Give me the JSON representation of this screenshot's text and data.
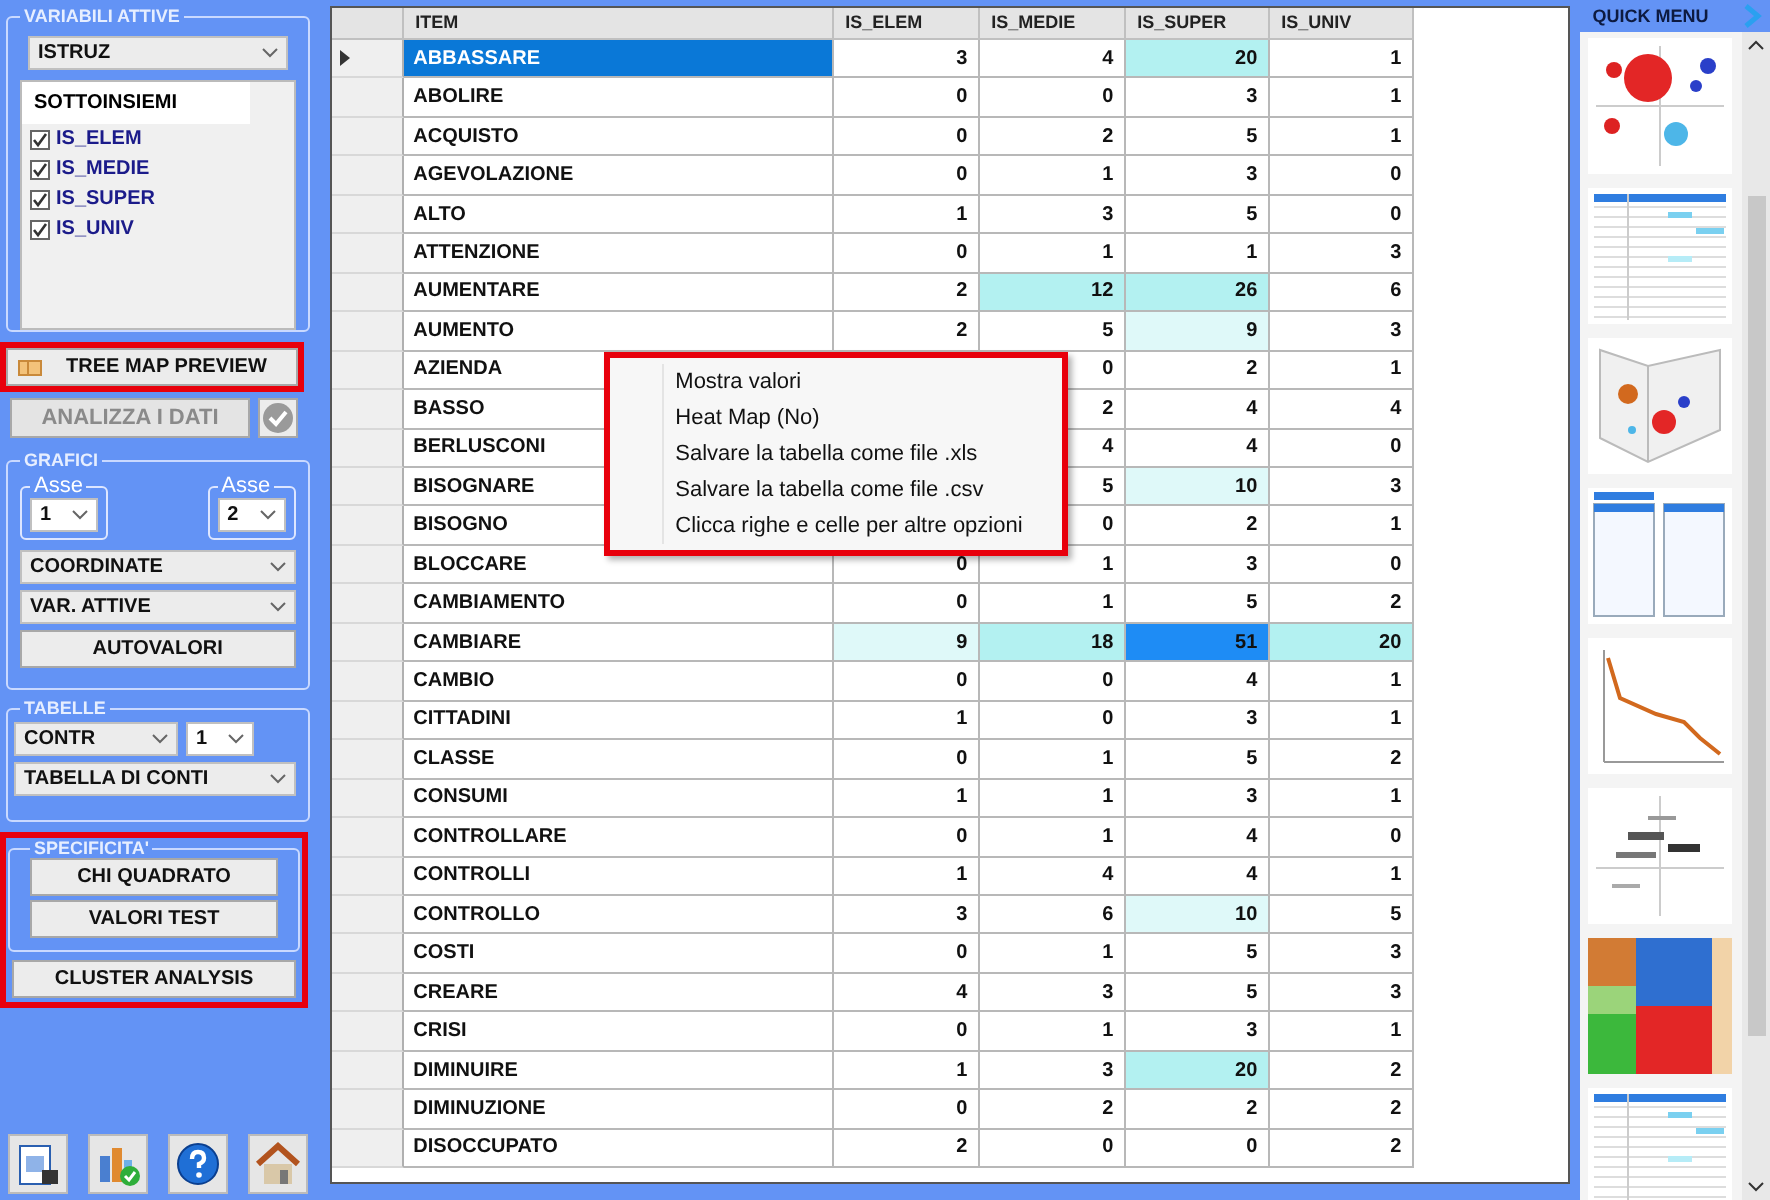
{
  "sidebar": {
    "active_variables": {
      "title": "VARIABILI ATTIVE",
      "dropdown": "ISTRUZ",
      "list_header": "SOTTOINSIEMI",
      "subsets": [
        {
          "label": "IS_ELEM",
          "checked": true
        },
        {
          "label": "IS_MEDIE",
          "checked": true
        },
        {
          "label": "IS_SUPER",
          "checked": true
        },
        {
          "label": "IS_UNIV",
          "checked": true
        }
      ]
    },
    "tree_map_button": {
      "label": "TREE MAP PREVIEW",
      "highlighted": true
    },
    "analyze_button": {
      "label": "ANALIZZA I DATI",
      "disabled": true
    },
    "charts": {
      "title": "GRAFICI",
      "axes": [
        {
          "label": "Asse",
          "value": "1"
        },
        {
          "label": "Asse",
          "value": "2"
        }
      ],
      "dropdowns": [
        "COORDINATE",
        "VAR. ATTIVE"
      ],
      "button": "AUTOVALORI"
    },
    "tables": {
      "title": "TABELLE",
      "dropdowns": [
        "CONTR",
        "1",
        "TABELLA DI CONTI"
      ]
    },
    "specificity": {
      "title": "SPECIFICITA'",
      "buttons": [
        "CHI QUADRATO",
        "VALORI TEST"
      ],
      "highlighted": true
    },
    "cluster_button": {
      "label": "CLUSTER ANALYSIS"
    }
  },
  "table": {
    "columns": [
      "ITEM",
      "IS_ELEM",
      "IS_MEDIE",
      "IS_SUPER",
      "IS_UNIV"
    ],
    "rows": [
      {
        "item": "ABBASSARE",
        "selected": true,
        "is_elem": {
          "value": "3"
        },
        "is_medie": {
          "value": "4"
        },
        "is_super": {
          "value": "20",
          "color": "#b3f1f1"
        },
        "is_univ": {
          "value": "1"
        }
      },
      {
        "item": "ABOLIRE",
        "selected": false,
        "is_elem": {
          "value": "0"
        },
        "is_medie": {
          "value": "0"
        },
        "is_super": {
          "value": "3"
        },
        "is_univ": {
          "value": "1"
        }
      },
      {
        "item": "ACQUISTO",
        "selected": false,
        "is_elem": {
          "value": "0"
        },
        "is_medie": {
          "value": "2"
        },
        "is_super": {
          "value": "5"
        },
        "is_univ": {
          "value": "1"
        }
      },
      {
        "item": "AGEVOLAZIONE",
        "selected": false,
        "is_elem": {
          "value": "0"
        },
        "is_medie": {
          "value": "1"
        },
        "is_super": {
          "value": "3"
        },
        "is_univ": {
          "value": "0"
        }
      },
      {
        "item": "ALTO",
        "selected": false,
        "is_elem": {
          "value": "1"
        },
        "is_medie": {
          "value": "3"
        },
        "is_super": {
          "value": "5"
        },
        "is_univ": {
          "value": "0"
        }
      },
      {
        "item": "ATTENZIONE",
        "selected": false,
        "is_elem": {
          "value": "0"
        },
        "is_medie": {
          "value": "1"
        },
        "is_super": {
          "value": "1"
        },
        "is_univ": {
          "value": "3"
        }
      },
      {
        "item": "AUMENTARE",
        "selected": false,
        "is_elem": {
          "value": "2"
        },
        "is_medie": {
          "value": "12",
          "color": "#b3f1f1"
        },
        "is_super": {
          "value": "26",
          "color": "#b3f1f1"
        },
        "is_univ": {
          "value": "6"
        }
      },
      {
        "item": "AUMENTO",
        "selected": false,
        "is_elem": {
          "value": "2"
        },
        "is_medie": {
          "value": "5"
        },
        "is_super": {
          "value": "9",
          "color": "#dff9f9"
        },
        "is_univ": {
          "value": "3"
        }
      },
      {
        "item": "AZIENDA",
        "selected": false,
        "is_medie": {
          "value": "0"
        },
        "is_super": {
          "value": "2"
        },
        "is_univ": {
          "value": "1"
        }
      },
      {
        "item": "BASSO",
        "selected": false,
        "is_medie": {
          "value": "2"
        },
        "is_super": {
          "value": "4"
        },
        "is_univ": {
          "value": "4"
        }
      },
      {
        "item": "BERLUSCONI",
        "selected": false,
        "is_medie": {
          "value": "4"
        },
        "is_super": {
          "value": "4"
        },
        "is_univ": {
          "value": "0"
        }
      },
      {
        "item": "BISOGNARE",
        "selected": false,
        "is_medie": {
          "value": "5"
        },
        "is_super": {
          "value": "10",
          "color": "#dff9f9"
        },
        "is_univ": {
          "value": "3"
        }
      },
      {
        "item": "BISOGNO",
        "selected": false,
        "is_medie": {
          "value": "0"
        },
        "is_super": {
          "value": "2"
        },
        "is_univ": {
          "value": "1"
        }
      },
      {
        "item": "BLOCCARE",
        "selected": false,
        "is_elem": {
          "value": "0"
        },
        "is_medie": {
          "value": "1"
        },
        "is_super": {
          "value": "3"
        },
        "is_univ": {
          "value": "0"
        }
      },
      {
        "item": "CAMBIAMENTO",
        "selected": false,
        "is_elem": {
          "value": "0"
        },
        "is_medie": {
          "value": "1"
        },
        "is_super": {
          "value": "5"
        },
        "is_univ": {
          "value": "2"
        }
      },
      {
        "item": "CAMBIARE",
        "selected": false,
        "is_elem": {
          "value": "9",
          "color": "#dff9f9"
        },
        "is_medie": {
          "value": "18",
          "color": "#b3f1f1"
        },
        "is_super": {
          "value": "51",
          "color": "#1e8cf5"
        },
        "is_univ": {
          "value": "20",
          "color": "#b3f1f1"
        }
      },
      {
        "item": "CAMBIO",
        "selected": false,
        "is_elem": {
          "value": "0"
        },
        "is_medie": {
          "value": "0"
        },
        "is_super": {
          "value": "4"
        },
        "is_univ": {
          "value": "1"
        }
      },
      {
        "item": "CITTADINI",
        "selected": false,
        "is_elem": {
          "value": "1"
        },
        "is_medie": {
          "value": "0"
        },
        "is_super": {
          "value": "3"
        },
        "is_univ": {
          "value": "1"
        }
      },
      {
        "item": "CLASSE",
        "selected": false,
        "is_elem": {
          "value": "0"
        },
        "is_medie": {
          "value": "1"
        },
        "is_super": {
          "value": "5"
        },
        "is_univ": {
          "value": "2"
        }
      },
      {
        "item": "CONSUMI",
        "selected": false,
        "is_elem": {
          "value": "1"
        },
        "is_medie": {
          "value": "1"
        },
        "is_super": {
          "value": "3"
        },
        "is_univ": {
          "value": "1"
        }
      },
      {
        "item": "CONTROLLARE",
        "selected": false,
        "is_elem": {
          "value": "0"
        },
        "is_medie": {
          "value": "1"
        },
        "is_super": {
          "value": "4"
        },
        "is_univ": {
          "value": "0"
        }
      },
      {
        "item": "CONTROLLI",
        "selected": false,
        "is_elem": {
          "value": "1"
        },
        "is_medie": {
          "value": "4"
        },
        "is_super": {
          "value": "4"
        },
        "is_univ": {
          "value": "1"
        }
      },
      {
        "item": "CONTROLLO",
        "selected": false,
        "is_elem": {
          "value": "3"
        },
        "is_medie": {
          "value": "6"
        },
        "is_super": {
          "value": "10",
          "color": "#dff9f9"
        },
        "is_univ": {
          "value": "5"
        }
      },
      {
        "item": "COSTI",
        "selected": false,
        "is_elem": {
          "value": "0"
        },
        "is_medie": {
          "value": "1"
        },
        "is_super": {
          "value": "5"
        },
        "is_univ": {
          "value": "3"
        }
      },
      {
        "item": "CREARE",
        "selected": false,
        "is_elem": {
          "value": "4"
        },
        "is_medie": {
          "value": "3"
        },
        "is_super": {
          "value": "5"
        },
        "is_univ": {
          "value": "3"
        }
      },
      {
        "item": "CRISI",
        "selected": false,
        "is_elem": {
          "value": "0"
        },
        "is_medie": {
          "value": "1"
        },
        "is_super": {
          "value": "3"
        },
        "is_univ": {
          "value": "1"
        }
      },
      {
        "item": "DIMINUIRE",
        "selected": false,
        "is_elem": {
          "value": "1"
        },
        "is_medie": {
          "value": "3"
        },
        "is_super": {
          "value": "20",
          "color": "#b3f1f1"
        },
        "is_univ": {
          "value": "2"
        }
      },
      {
        "item": "DIMINUZIONE",
        "selected": false,
        "is_elem": {
          "value": "0"
        },
        "is_medie": {
          "value": "2"
        },
        "is_super": {
          "value": "2"
        },
        "is_univ": {
          "value": "2"
        }
      },
      {
        "item": "DISOCCUPATO",
        "selected": false,
        "is_elem": {
          "value": "2"
        },
        "is_medie": {
          "value": "0"
        },
        "is_super": {
          "value": "0"
        },
        "is_univ": {
          "value": "2"
        }
      }
    ]
  },
  "context_menu": {
    "highlighted": true,
    "items": [
      "Mostra valori",
      "Heat Map (No)",
      "Salvare la tabella come file .xls",
      "Salvare la tabella come file .csv",
      "Clicca righe e celle per altre opzioni"
    ]
  },
  "quick_menu": {
    "title": "QUICK MENU",
    "thumbnails": [
      {
        "kind": "bubble"
      },
      {
        "kind": "table"
      },
      {
        "kind": "scatter3d"
      },
      {
        "kind": "tables"
      },
      {
        "kind": "line"
      },
      {
        "kind": "wordmap"
      },
      {
        "kind": "treemap"
      },
      {
        "kind": "report"
      }
    ]
  }
}
